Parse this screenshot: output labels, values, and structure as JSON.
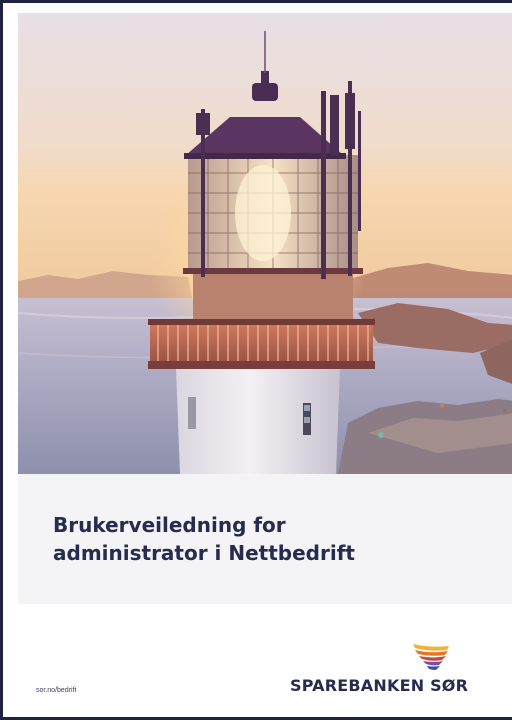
{
  "cover": {
    "title_line1": "Brukerveiledning for",
    "title_line2": "administrator i Nettbedrift",
    "url": "sor.no/bedrift",
    "brand_name": "SPAREBANKEN SØR",
    "brand_logo": "sparebanken-sor-wave-logo",
    "hero_image": "lighthouse at sunset on rocky coast"
  },
  "colors": {
    "title": "#262b4f",
    "title_band": "#f4f4f6",
    "border": "#1f2340",
    "logo_yellow": "#f2b233",
    "logo_orange": "#e8742c",
    "logo_red": "#d8403a",
    "logo_purple": "#7a4ea8",
    "logo_blue": "#3d4fa3"
  }
}
